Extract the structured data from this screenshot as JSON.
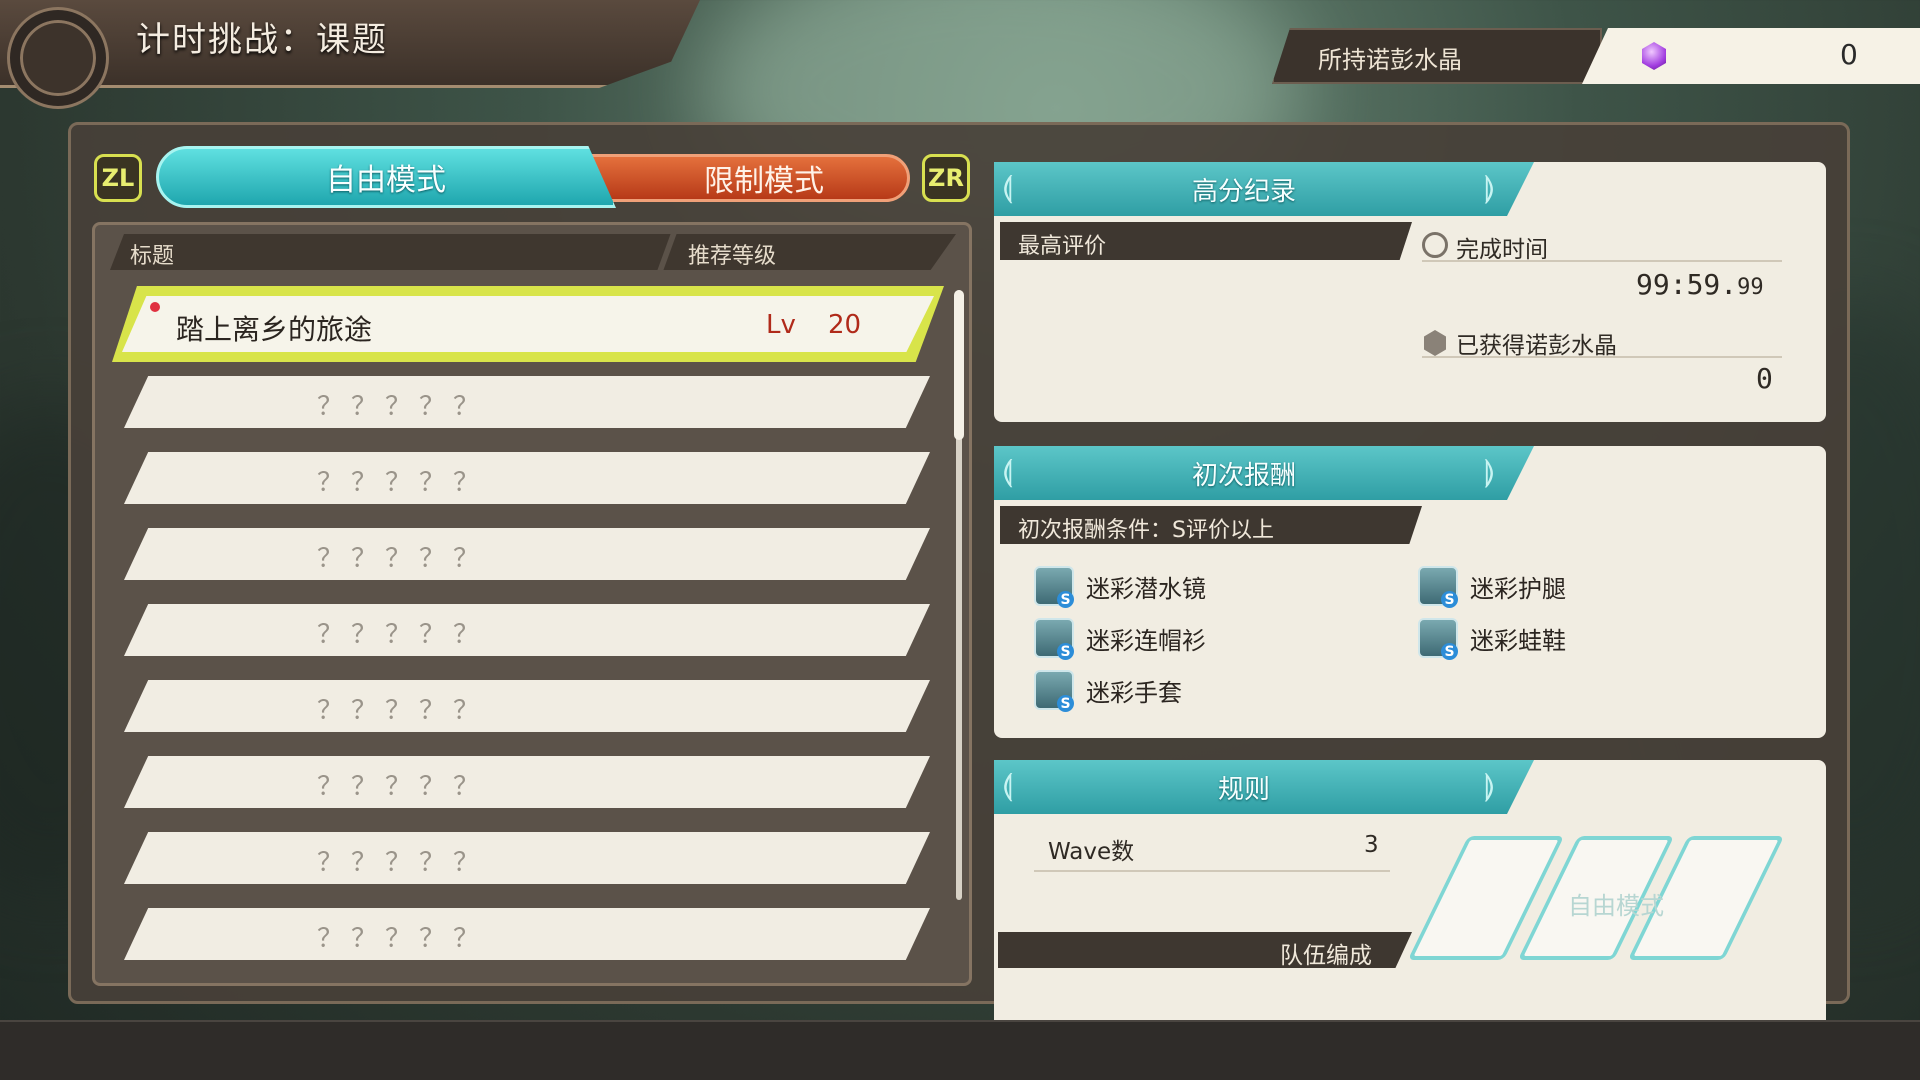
{
  "header": {
    "title": "计时挑战：课题"
  },
  "currency": {
    "label": "所持诺彭水晶",
    "value": "0",
    "icon": "crystal-icon",
    "color": "#a23ee0"
  },
  "mode_tabs": {
    "left_button": "ZL",
    "right_button": "ZR",
    "free": "自由模式",
    "limited": "限制模式",
    "active": "free"
  },
  "quest_list": {
    "col_title": "标题",
    "col_level": "推荐等级",
    "selected": {
      "name": "踏上离乡的旅途",
      "lv_label": "Lv",
      "lv": "20",
      "new": true
    },
    "locked_label": "？？？？？",
    "locked_rows": [
      "？？？？？",
      "？？？？？",
      "？？？？？",
      "？？？？？",
      "？？？？？",
      "？？？？？",
      "？？？？？",
      "？？？？？"
    ]
  },
  "highscore": {
    "heading": "高分纪录",
    "best_rating_label": "最高评价",
    "clear_time_label": "完成时间",
    "clear_time_main": "99:59.",
    "clear_time_frac": "99",
    "crystals_label": "已获得诺彭水晶",
    "crystals_value": "0"
  },
  "first_reward": {
    "heading": "初次报酬",
    "condition": "初次报酬条件：S评价以上",
    "items": [
      {
        "name": "迷彩潜水镜",
        "icon": "goggles-icon"
      },
      {
        "name": "迷彩护腿",
        "icon": "leg-armor-icon"
      },
      {
        "name": "迷彩连帽衫",
        "icon": "hoodie-icon"
      },
      {
        "name": "迷彩蛙鞋",
        "icon": "flippers-icon"
      },
      {
        "name": "迷彩手套",
        "icon": "gloves-icon"
      }
    ]
  },
  "rules": {
    "heading": "规则",
    "wave_label": "Wave数",
    "wave_value": "3",
    "party_label": "队伍编成",
    "deco_text": "自由模式"
  },
  "colors": {
    "accent_teal": "#2f9ea4",
    "accent_red": "#b73a18",
    "highlight_yellow": "#d8e44a"
  }
}
